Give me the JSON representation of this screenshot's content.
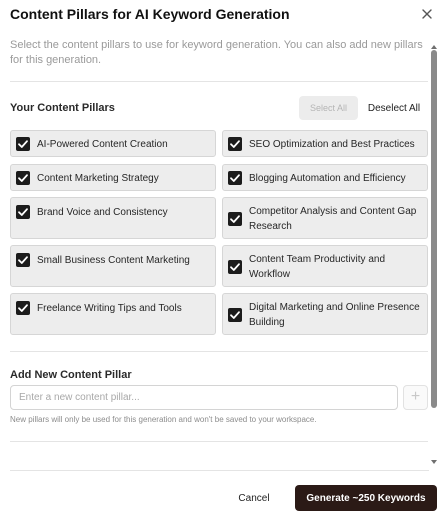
{
  "dialog": {
    "title": "Content Pillars for AI Keyword Generation",
    "description": "Select the content pillars to use for keyword generation. You can also add new pillars for this generation."
  },
  "pillars_section": {
    "title": "Your Content Pillars",
    "select_all_label": "Select All",
    "deselect_all_label": "Deselect All",
    "items": [
      {
        "label": "AI-Powered Content Creation",
        "checked": true
      },
      {
        "label": "SEO Optimization and Best Practices",
        "checked": true
      },
      {
        "label": "Content Marketing Strategy",
        "checked": true
      },
      {
        "label": "Blogging Automation and Efficiency",
        "checked": true
      },
      {
        "label": "Brand Voice and Consistency",
        "checked": true
      },
      {
        "label": "Competitor Analysis and Content Gap Research",
        "checked": true
      },
      {
        "label": "Small Business Content Marketing",
        "checked": true
      },
      {
        "label": "Content Team Productivity and Workflow",
        "checked": true
      },
      {
        "label": "Freelance Writing Tips and Tools",
        "checked": true
      },
      {
        "label": "Digital Marketing and Online Presence Building",
        "checked": true
      }
    ]
  },
  "add_section": {
    "title": "Add New Content Pillar",
    "input_placeholder": "Enter a new content pillar...",
    "input_value": "",
    "add_button_label": "+",
    "hint": "New pillars will only be used for this generation and won't be saved to your workspace."
  },
  "footer": {
    "cancel_label": "Cancel",
    "generate_label": "Generate ~250 Keywords"
  },
  "colors": {
    "primary_button": "#2b1a16",
    "pill_background": "#ededed",
    "checkbox": "#1c1c1c"
  }
}
